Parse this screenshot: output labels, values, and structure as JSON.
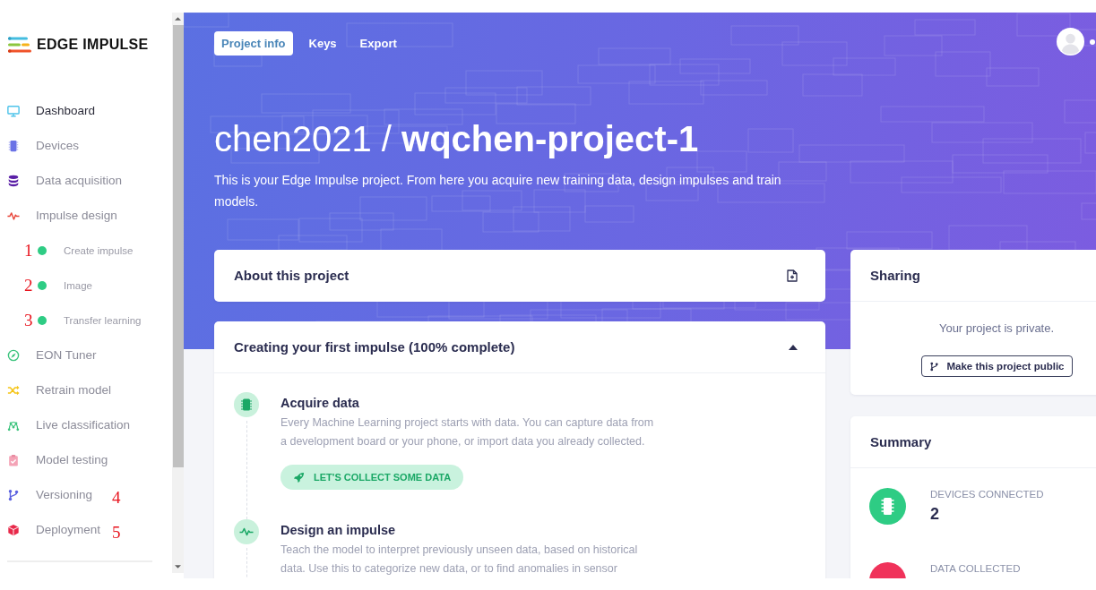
{
  "sidebar": {
    "logo": "EDGE IMPULSE",
    "items": [
      {
        "label": "Dashboard",
        "selected": true
      },
      {
        "label": "Devices",
        "selected": false
      },
      {
        "label": "Data acquisition",
        "selected": false
      },
      {
        "label": "Impulse design",
        "selected": false,
        "children": [
          {
            "label": "Create impulse",
            "selected": false,
            "complete": true,
            "annotation": "1"
          },
          {
            "label": "Image",
            "selected": false,
            "complete": true,
            "annotation": "2"
          },
          {
            "label": "Transfer learning",
            "selected": false,
            "complete": true,
            "annotation": "3"
          }
        ]
      },
      {
        "label": "EON Tuner",
        "selected": false
      },
      {
        "label": "Retrain model",
        "selected": false
      },
      {
        "label": "Live classification",
        "selected": false
      },
      {
        "label": "Model testing",
        "selected": false
      },
      {
        "label": "Versioning",
        "selected": false,
        "annotation": "4"
      },
      {
        "label": "Deployment",
        "selected": false,
        "annotation": "5"
      }
    ]
  },
  "header": {
    "tabs": [
      {
        "label": "Project info",
        "selected": true
      },
      {
        "label": "Keys",
        "selected": false
      },
      {
        "label": "Export",
        "selected": false
      }
    ],
    "title": "chen2021 / **wqchen-project-1**",
    "description": "This is your Edge Impulse project. From here you acquire new training data, design impulses and train models."
  },
  "about_card": {
    "title": "About this project"
  },
  "impulse_card": {
    "title": "Creating your first impulse (100% complete)",
    "expanded": true,
    "steps": [
      {
        "title": "Acquire data",
        "description": "Every Machine Learning project starts with data. You can capture data from a development board or your phone, or import data you already collected.",
        "button": "LET'S COLLECT SOME DATA"
      },
      {
        "title": "Design an impulse",
        "description": "Teach the model to interpret previously unseen data, based on historical data. Use this to categorize new data, or to find anomalies in sensor"
      }
    ]
  },
  "sharing_card": {
    "title": "Sharing",
    "status": "Your project is private.",
    "button": "Make this project public"
  },
  "summary_card": {
    "title": "Summary",
    "stats": [
      {
        "label": "DEVICES CONNECTED",
        "value": "2",
        "color": "#2ecc84"
      },
      {
        "label": "DATA COLLECTED",
        "color": "#f0325a"
      }
    ]
  }
}
